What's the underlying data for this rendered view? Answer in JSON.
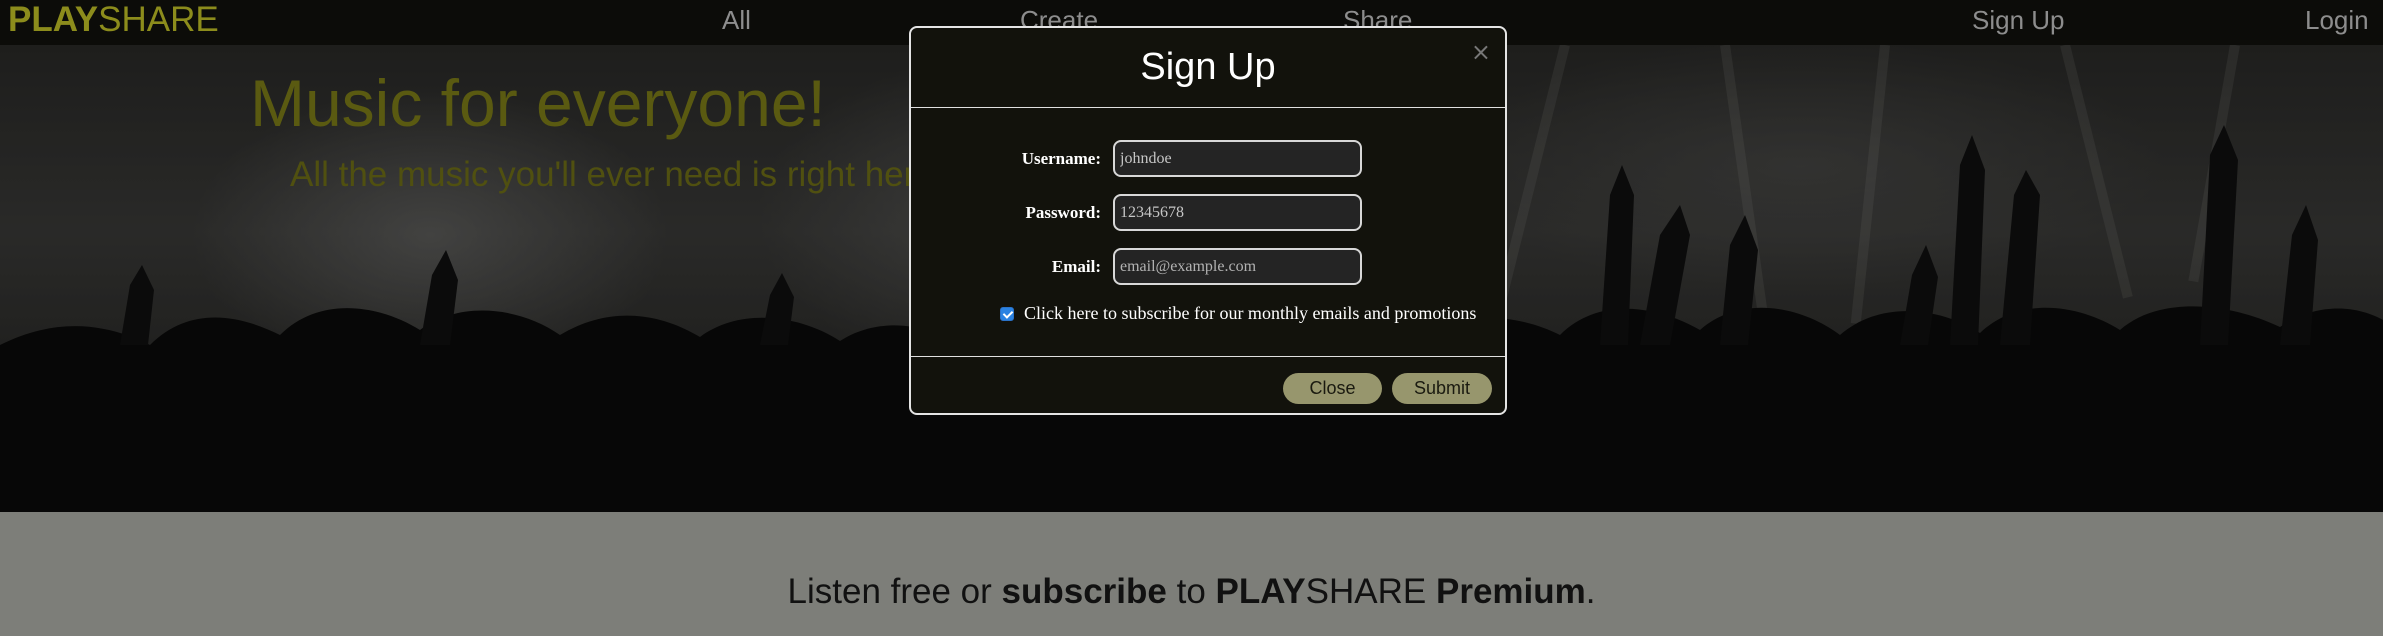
{
  "nav": {
    "brand_bold": "PLAY",
    "brand_light": "SHARE",
    "links": [
      "All",
      "Create",
      "Share"
    ],
    "signup": "Sign Up",
    "login": "Login"
  },
  "hero": {
    "title": "Music for everyone!",
    "subtitle": "All the music you'll ever need is right here."
  },
  "band": {
    "prefix": "Listen free or ",
    "bold_word": "subscribe",
    "middle": " to ",
    "brand_bold": "PLAY",
    "brand_light": "SHARE",
    "premium": " Premium",
    "suffix": "."
  },
  "modal": {
    "title": "Sign Up",
    "close_glyph": "×",
    "fields": [
      {
        "label": "Username:",
        "value": "johndoe",
        "placeholder": ""
      },
      {
        "label": "Password:",
        "value": "12345678",
        "placeholder": ""
      },
      {
        "label": "Email:",
        "value": "",
        "placeholder": "email@example.com"
      }
    ],
    "subscribe_checked": true,
    "subscribe_label": "Click here to subscribe for our monthly emails and promotions",
    "close_button": "Close",
    "submit_button": "Submit"
  }
}
